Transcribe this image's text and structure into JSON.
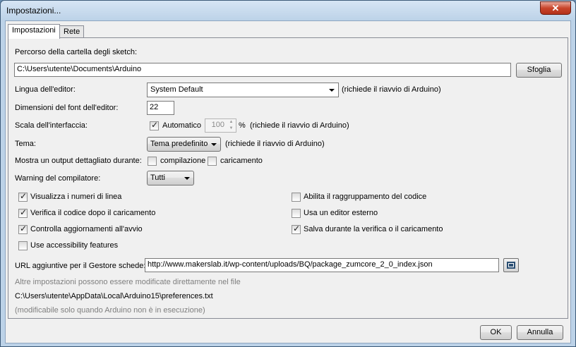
{
  "window": {
    "title": "Impostazioni...",
    "close_label": "✕"
  },
  "tabs": [
    {
      "label": "Impostazioni"
    },
    {
      "label": "Rete"
    }
  ],
  "sketch_folder": {
    "label": "Percorso della cartella degli sketch:",
    "value": "C:\\Users\\utente\\Documents\\Arduino",
    "browse_label": "Sfoglia"
  },
  "language": {
    "label": "Lingua dell'editor:",
    "value": "System Default",
    "note": "(richiede il riavvio di Arduino)"
  },
  "font_size": {
    "label": "Dimensioni del font dell'editor:",
    "value": "22"
  },
  "scale": {
    "label": "Scala dell'interfaccia:",
    "auto_label": "Automatico",
    "value": "100",
    "unit": "%",
    "note": "(richiede il riavvio di Arduino)"
  },
  "theme": {
    "label": "Tema:",
    "value": "Tema predefinito",
    "note": "(richiede il riavvio di Arduino)"
  },
  "verbose": {
    "label": "Mostra un output dettagliato durante:",
    "compile_label": "compilazione",
    "upload_label": "caricamento"
  },
  "warnings": {
    "label": "Warning del compilatore:",
    "value": "Tutti"
  },
  "options_left": [
    {
      "label": "Visualizza i numeri di linea",
      "checked": true
    },
    {
      "label": "Verifica il codice dopo il caricamento",
      "checked": true
    },
    {
      "label": "Controlla aggiornamenti all'avvio",
      "checked": true
    },
    {
      "label": "Use accessibility features",
      "checked": false
    }
  ],
  "options_right": [
    {
      "label": "Abilita il raggruppamento del codice",
      "checked": false
    },
    {
      "label": "Usa un editor esterno",
      "checked": false
    },
    {
      "label": "Salva durante la verifica o il caricamento",
      "checked": true
    }
  ],
  "boards_url": {
    "label": "URL aggiuntive per il Gestore schede:",
    "value": "http://www.makerslab.it/wp-content/uploads/BQ/package_zumcore_2_0_index.json"
  },
  "footer": {
    "more_prefs": "Altre impostazioni possono essere modificate direttamente nel file",
    "prefs_path": "C:\\Users\\utente\\AppData\\Local\\Arduino15\\preferences.txt",
    "edit_note": "(modificabile solo quando Arduino non è in esecuzione)"
  },
  "buttons": {
    "ok": "OK",
    "cancel": "Annulla"
  }
}
